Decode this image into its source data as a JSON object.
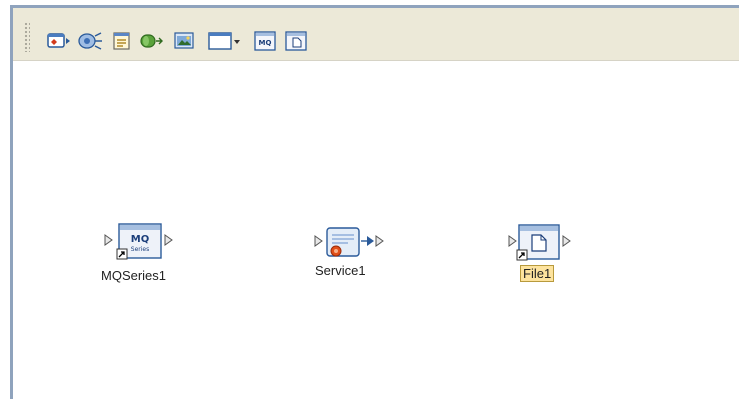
{
  "toolbar": {
    "tools": [
      {
        "name": "external-application-tool"
      },
      {
        "name": "web-service-tool"
      },
      {
        "name": "business-process-tool"
      },
      {
        "name": "collaboration-tool"
      },
      {
        "name": "image-tool"
      },
      {
        "name": "window-dropdown-tool"
      },
      {
        "name": "mqseries-tool",
        "icon_text": "MQ"
      },
      {
        "name": "file-tool"
      }
    ]
  },
  "canvas": {
    "components": [
      {
        "id": "mqseries",
        "label": "MQSeries1",
        "icon_text": "MQ",
        "icon_subtext": "Series",
        "selected": false
      },
      {
        "id": "service",
        "label": "Service1",
        "selected": false
      },
      {
        "id": "file",
        "label": "File1",
        "selected": true
      }
    ]
  },
  "colors": {
    "toolbar_bg": "#ece9d8",
    "frame": "#8fa3bd",
    "selection_bg": "#fde39e"
  }
}
